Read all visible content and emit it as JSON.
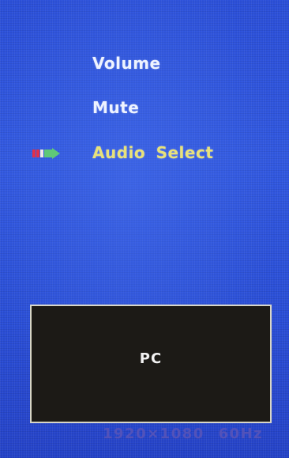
{
  "osd_menu": {
    "items": [
      {
        "label": "Volume",
        "selected": false
      },
      {
        "label": "Mute",
        "selected": false
      },
      {
        "label": "Audio Select",
        "selected": true
      }
    ],
    "selection_icon": "pointer-arrow-icon"
  },
  "preview": {
    "source_label": "PC"
  },
  "status": {
    "resolution": "1920×1080",
    "refresh_rate": "60Hz"
  },
  "colors": {
    "background": "#2b4fd8",
    "item_text": "#eef3ff",
    "selected_text": "#e8e27a",
    "preview_bg": "#1c1a16",
    "cursor_red": "#e0304a",
    "cursor_green": "#5fc878"
  }
}
